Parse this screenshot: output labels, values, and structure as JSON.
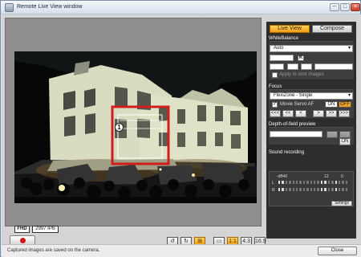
{
  "window": {
    "title": "Remote Live View window",
    "controls": {
      "minimize": "─",
      "maximize": "□",
      "close": "×"
    }
  },
  "tabs": {
    "live_view": "Live View",
    "compose": "Compose"
  },
  "white_balance": {
    "title": "WhiteBalance",
    "mode": "Auto",
    "k_label": "K",
    "apply_shot_label": "Apply to shot images"
  },
  "focus": {
    "title": "Focus",
    "mode": "FlexiZone - Single",
    "movie_servo_label": "Movie Servo AF",
    "on_label": "ON",
    "off_label": "OFF",
    "focus_buttons": [
      "<<<",
      "<<",
      "<",
      ">",
      ">>",
      ">>>"
    ]
  },
  "depth_of_field": {
    "title": "Depth-of-field preview",
    "on_label": "ON"
  },
  "sound": {
    "title": "Sound recording",
    "left_label": "L",
    "right_label": "R",
    "scale_left": "-dB40",
    "scale_mid": "12",
    "scale_right": "0",
    "settings_label": "Settings"
  },
  "live_view": {
    "badge": "1"
  },
  "status": {
    "message": "Captured images are saved on the camera.",
    "close_label": "Close"
  },
  "overlay": {
    "fhd": "FHD",
    "fps": "2997 IPB"
  },
  "icons": {
    "rotate_left": "↺",
    "rotate_right": "↻",
    "zoom": "⊞",
    "aspect": "▭",
    "ratio_a": "1:1",
    "ratio_b": "4:3",
    "ratio_c": "16:9"
  }
}
